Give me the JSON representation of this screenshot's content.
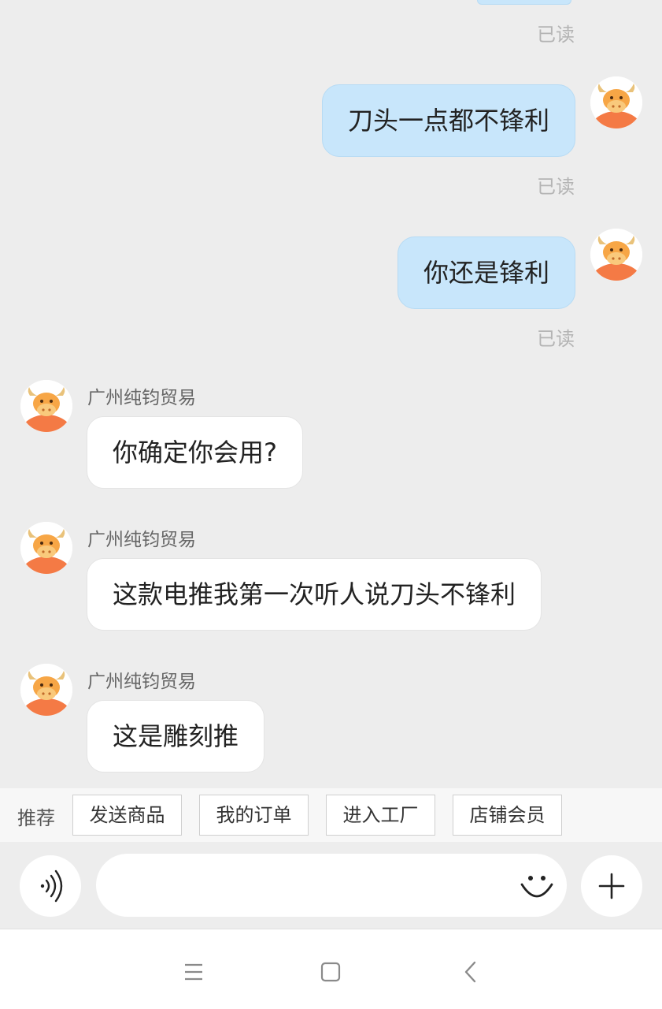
{
  "messages": [
    {
      "direction": "out",
      "text": "",
      "status": "已读"
    },
    {
      "direction": "out",
      "text": "刀头一点都不锋利",
      "status": "已读"
    },
    {
      "direction": "out",
      "text": "你还是锋利",
      "status": "已读"
    },
    {
      "direction": "in",
      "sender": "广州纯钧贸易",
      "text": "你确定你会用?"
    },
    {
      "direction": "in",
      "sender": "广州纯钧贸易",
      "text": "这款电推我第一次听人说刀头不锋利"
    },
    {
      "direction": "in",
      "sender": "广州纯钧贸易",
      "text": "这是雕刻推"
    }
  ],
  "recommend": {
    "label": "推荐",
    "chips": [
      "发送商品",
      "我的订单",
      "进入工厂",
      "店铺会员"
    ]
  },
  "input": {
    "value": "",
    "placeholder": ""
  },
  "icons": {
    "voice": "voice-icon",
    "emoji": "emoji-icon",
    "plus": "plus-icon",
    "menu": "menu-icon",
    "home": "home-icon",
    "back": "back-icon"
  },
  "colors": {
    "background": "#ededed",
    "outgoing_bubble": "#c8e6fb",
    "incoming_bubble": "#ffffff",
    "avatar_orange": "#f47a45"
  }
}
